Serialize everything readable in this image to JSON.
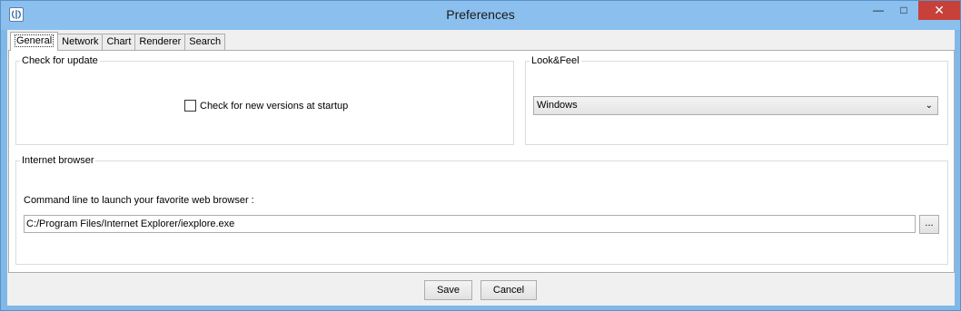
{
  "window": {
    "title": "Preferences",
    "min_glyph": "—",
    "max_glyph": "□",
    "close_glyph": "✕"
  },
  "tabs": [
    {
      "label": "General",
      "active": true
    },
    {
      "label": "Network"
    },
    {
      "label": "Chart"
    },
    {
      "label": "Renderer"
    },
    {
      "label": "Search"
    }
  ],
  "check_for_update": {
    "title": "Check for update",
    "checkbox_label": "Check for new versions at startup",
    "checked": false
  },
  "look_and_feel": {
    "title": "Look&Feel",
    "selected": "Windows",
    "chevron": "⌄"
  },
  "internet_browser": {
    "title": "Internet browser",
    "command_label": "Command line to launch your favorite web browser :",
    "command_value": "C:/Program Files/Internet Explorer/iexplore.exe",
    "browse_label": "..."
  },
  "actions": {
    "save": "Save",
    "cancel": "Cancel"
  },
  "colors": {
    "titlebar": "#8bbfee",
    "close_button": "#c7403a"
  }
}
